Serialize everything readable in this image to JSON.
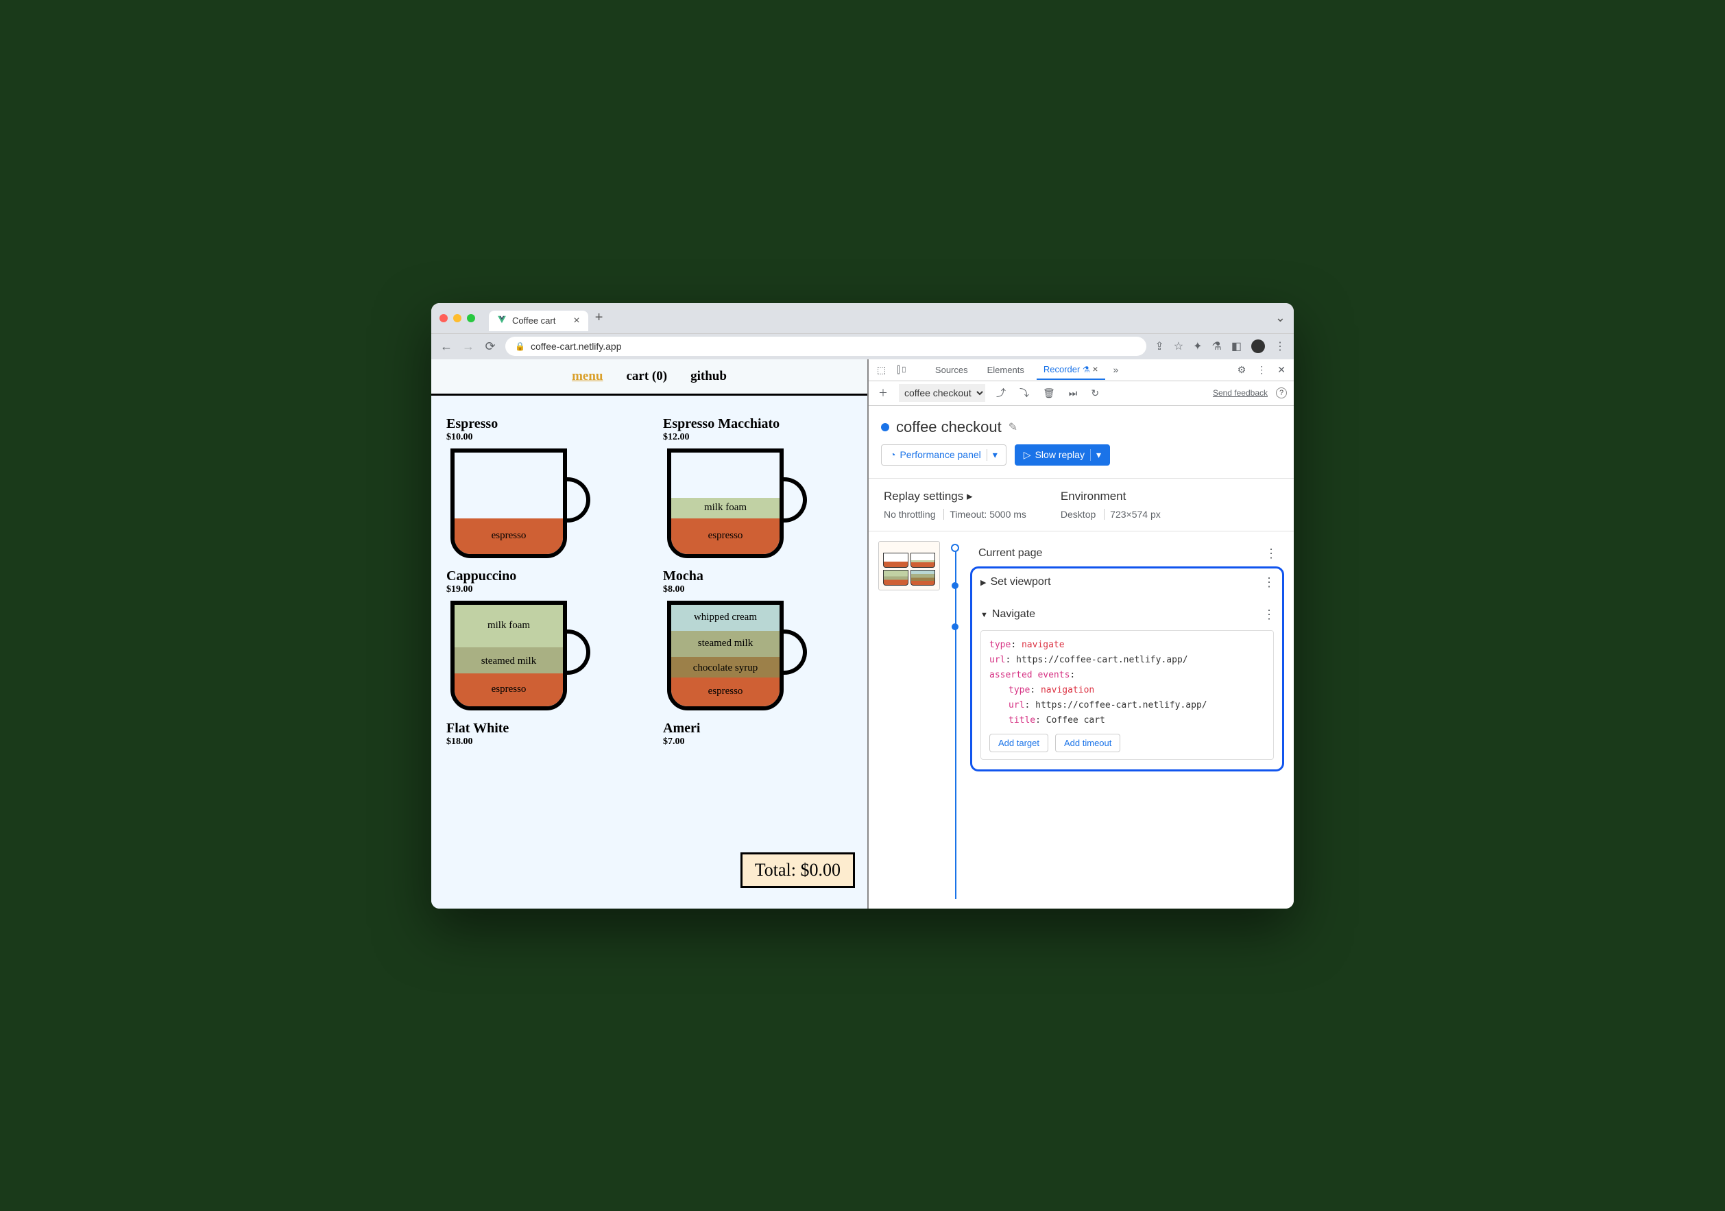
{
  "browser": {
    "tab_title": "Coffee cart",
    "url": "coffee-cart.netlify.app"
  },
  "page": {
    "nav": {
      "menu": "menu",
      "cart": "cart (0)",
      "github": "github"
    },
    "products": [
      {
        "name": "Espresso",
        "price": "$10.00"
      },
      {
        "name": "Espresso Macchiato",
        "price": "$12.00"
      },
      {
        "name": "Cappuccino",
        "price": "$19.00"
      },
      {
        "name": "Mocha",
        "price": "$8.00"
      },
      {
        "name": "Flat White",
        "price": "$18.00"
      },
      {
        "name": "Ameri",
        "price": "$7.00"
      }
    ],
    "layers": {
      "espresso": "espresso",
      "milk_foam": "milk foam",
      "steamed_milk": "steamed milk",
      "whipped_cream": "whipped cream",
      "chocolate_syrup": "chocolate syrup"
    },
    "total": "Total: $0.00"
  },
  "devtools": {
    "tabs": {
      "sources": "Sources",
      "elements": "Elements",
      "recorder": "Recorder"
    },
    "recording_select": "coffee checkout",
    "feedback": "Send feedback",
    "recording_title": "coffee checkout",
    "perf_btn": "Performance panel",
    "replay_btn": "Slow replay",
    "settings": {
      "replay_title": "Replay settings",
      "throttle": "No throttling",
      "timeout": "Timeout: 5000 ms",
      "env_title": "Environment",
      "device": "Desktop",
      "viewport": "723×574 px"
    },
    "steps": {
      "current_page": "Current page",
      "set_viewport": "Set viewport",
      "navigate": "Navigate",
      "code": {
        "k_type": "type",
        "v_type": ": ",
        "v_nav": "navigate",
        "k_url": "url",
        "url_val": ": https://coffee-cart.netlify.app/",
        "k_assert": "asserted events",
        "colon": ":",
        "v_navigation": "navigation",
        "k_title": "title",
        "title_val": ": Coffee cart"
      },
      "add_target": "Add target",
      "add_timeout": "Add timeout"
    }
  }
}
